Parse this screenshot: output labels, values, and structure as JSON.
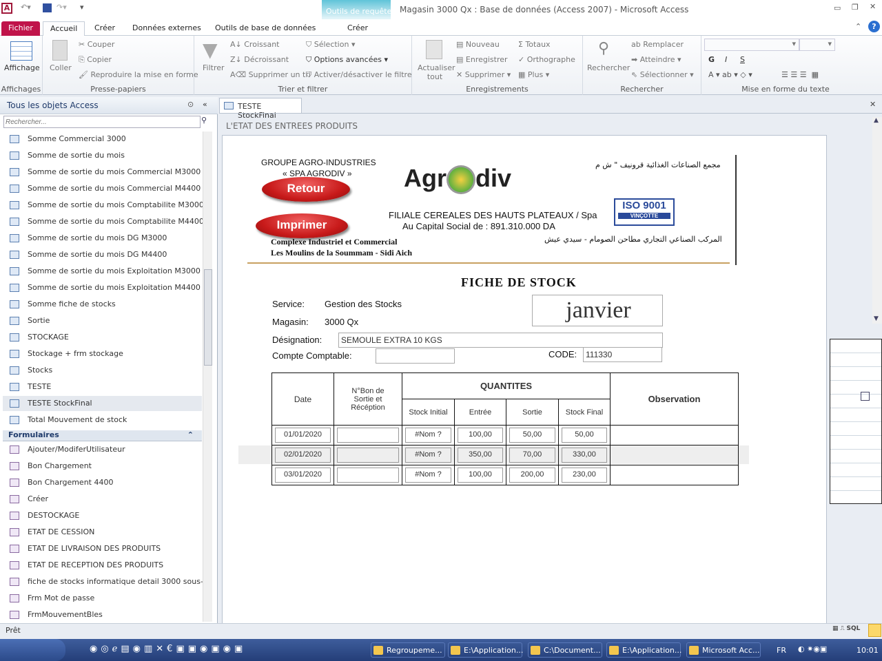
{
  "app": {
    "title": "Magasin 3000 Qx : Base de données (Access 2007)  -  Microsoft Access",
    "context_tab": "Outils de requête",
    "context_sub": "Créer"
  },
  "ribbon_tabs": [
    "Fichier",
    "Accueil",
    "Créer",
    "Données externes",
    "Outils de base de données"
  ],
  "ribbon": {
    "affichages": {
      "button": "Affichage",
      "label": "Affichages"
    },
    "presse": {
      "coller": "Coller",
      "couper": "Couper",
      "copier": "Copier",
      "reproduire": "Reproduire la mise en forme",
      "label": "Presse-papiers"
    },
    "trier": {
      "filtrer": "Filtrer",
      "croissant": "Croissant",
      "decroissant": "Décroissant",
      "supprimer_tri": "Supprimer un tri",
      "selection": "Sélection",
      "options": "Options avancées",
      "activer": "Activer/désactiver le filtre",
      "label": "Trier et filtrer"
    },
    "enreg": {
      "actualiser": "Actualiser tout",
      "nouveau": "Nouveau",
      "enregistrer": "Enregistrer",
      "supprimer": "Supprimer",
      "totaux": "Totaux",
      "orthographe": "Orthographe",
      "plus": "Plus",
      "label": "Enregistrements"
    },
    "rech": {
      "rechercher": "Rechercher",
      "remplacer": "Remplacer",
      "atteindre": "Atteindre",
      "selectionner": "Sélectionner",
      "label": "Rechercher"
    },
    "texte": {
      "label": "Mise en forme du texte",
      "bold": "G",
      "italic": "I",
      "underline": "S"
    }
  },
  "nav": {
    "title": "Tous les objets Access",
    "search_placeholder": "Rechercher...",
    "queries": [
      "Somme Commercial 3000",
      "Somme de sortie du mois",
      "Somme de sortie du mois Commercial M3000",
      "Somme de sortie du mois Commercial M4400",
      "Somme de sortie du mois Comptabilite M3000",
      "Somme de sortie du mois Comptabilite M4400",
      "Somme de sortie du mois DG M3000",
      "Somme de sortie du mois DG M4400",
      "Somme de sortie du mois Exploitation M3000",
      "Somme de sortie du mois Exploitation M4400",
      "Somme fiche de stocks",
      "Sortie",
      "STOCKAGE",
      "Stockage + frm stockage",
      "Stocks",
      "TESTE",
      "TESTE StockFinal",
      "Total Mouvement de stock"
    ],
    "selected": "TESTE StockFinal",
    "forms_header": "Formulaires",
    "forms": [
      "Ajouter/ModiferUtilisateur",
      "Bon Chargement",
      "Bon Chargement 4400",
      "Créer",
      "DESTOCKAGE",
      "ETAT DE CESSION",
      "ETAT DE LIVRAISON DES PRODUITS",
      "ETAT DE RECEPTION DES PRODUITS",
      "fiche de stocks informatique detail 3000 sous-...",
      "Frm Mot de passe",
      "FrmMouvementBles"
    ]
  },
  "document": {
    "tab": "TESTE StockFinal",
    "section_header": "L'ETAT DES ENTREES PRODUITS"
  },
  "letterhead": {
    "group": "GROUPE AGRO-INDUSTRIES",
    "spa": "« SPA AGRODIV »",
    "logo": "Agrodiv",
    "arabic_top": "مجمع الصناعات الغذائية قرونيف \" ش م",
    "filiale": "FILIALE  CEREALES DES HAUTS PLATEAUX / Spa",
    "capital": "Au Capital Social de : 891.310.000 DA",
    "iso": "ISO 9001",
    "complexe": "Complexe Industriel et Commercial",
    "moulins": "Les Moulins de la Soummam - Sidi Aich",
    "arabic_bottom": "المركب الصناعي التجاري مطاحن الصومام - سيدي عيش"
  },
  "buttons": {
    "retour": "Retour",
    "imprimer": "Imprimer"
  },
  "fiche": {
    "title": "FICHE DE STOCK",
    "service_label": "Service:",
    "service": "Gestion des Stocks",
    "magasin_label": "Magasin:",
    "magasin": "3000 Qx",
    "month": "janvier",
    "designation_label": "Désignation:",
    "designation": "SEMOULE EXTRA 10 KGS",
    "compte_label": "Compte Comptable:",
    "compte": "",
    "code_label": "CODE:",
    "code": "111330"
  },
  "table": {
    "headers": {
      "date": "Date",
      "bon": "N°Bon de Sortie et Récéption",
      "quantites": "QUANTITES",
      "stock_initial": "Stock Initial",
      "entree": "Entrée",
      "sortie": "Sortie",
      "stock_final": "Stock Final",
      "observation": "Observation"
    },
    "rows": [
      {
        "date": "01/01/2020",
        "bon": "",
        "stock_initial": "#Nom ?",
        "entree": "100,00",
        "sortie": "50,00",
        "stock_final": "50,00"
      },
      {
        "date": "02/01/2020",
        "bon": "",
        "stock_initial": "#Nom ?",
        "entree": "350,00",
        "sortie": "70,00",
        "stock_final": "330,00"
      },
      {
        "date": "03/01/2020",
        "bon": "",
        "stock_initial": "#Nom ?",
        "entree": "100,00",
        "sortie": "200,00",
        "stock_final": "230,00"
      }
    ]
  },
  "status": {
    "text": "Prêt",
    "sql": "SQL"
  },
  "taskbar": {
    "items": [
      "Regroupeme...",
      "E:\\Application...",
      "C:\\Document...",
      "E:\\Application...",
      "Microsoft Acc..."
    ],
    "lang": "FR",
    "clock": "10:01"
  },
  "colors": {
    "fichier": "#c0134a",
    "context": "#5fc3d8",
    "button_red": "#c81a1a",
    "rule": "#c8a060"
  }
}
